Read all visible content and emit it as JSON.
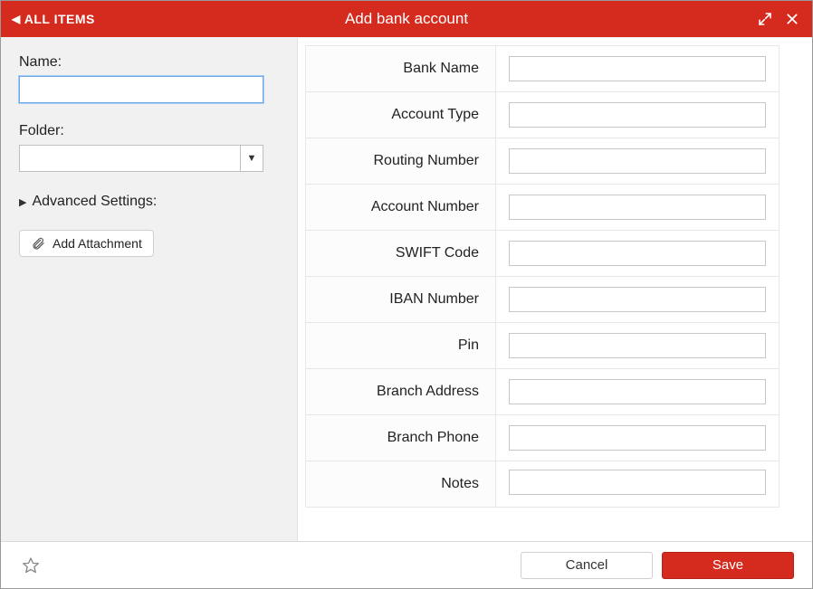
{
  "colors": {
    "accent": "#d52b1e"
  },
  "titlebar": {
    "back_label": "ALL ITEMS",
    "title": "Add bank account"
  },
  "left": {
    "name_label": "Name:",
    "name_value": "",
    "folder_label": "Folder:",
    "folder_value": "",
    "advanced_label": "Advanced Settings:",
    "attach_label": "Add Attachment"
  },
  "fields": [
    {
      "label": "Bank Name",
      "value": "",
      "type": "text"
    },
    {
      "label": "Account Type",
      "value": "",
      "type": "text"
    },
    {
      "label": "Routing Number",
      "value": "",
      "type": "text"
    },
    {
      "label": "Account Number",
      "value": "",
      "type": "text"
    },
    {
      "label": "SWIFT Code",
      "value": "",
      "type": "text"
    },
    {
      "label": "IBAN Number",
      "value": "",
      "type": "text"
    },
    {
      "label": "Pin",
      "value": "",
      "type": "text"
    },
    {
      "label": "Branch Address",
      "value": "",
      "type": "text"
    },
    {
      "label": "Branch Phone",
      "value": "",
      "type": "text"
    },
    {
      "label": "Notes",
      "value": "",
      "type": "textarea"
    }
  ],
  "footer": {
    "cancel_label": "Cancel",
    "save_label": "Save"
  }
}
